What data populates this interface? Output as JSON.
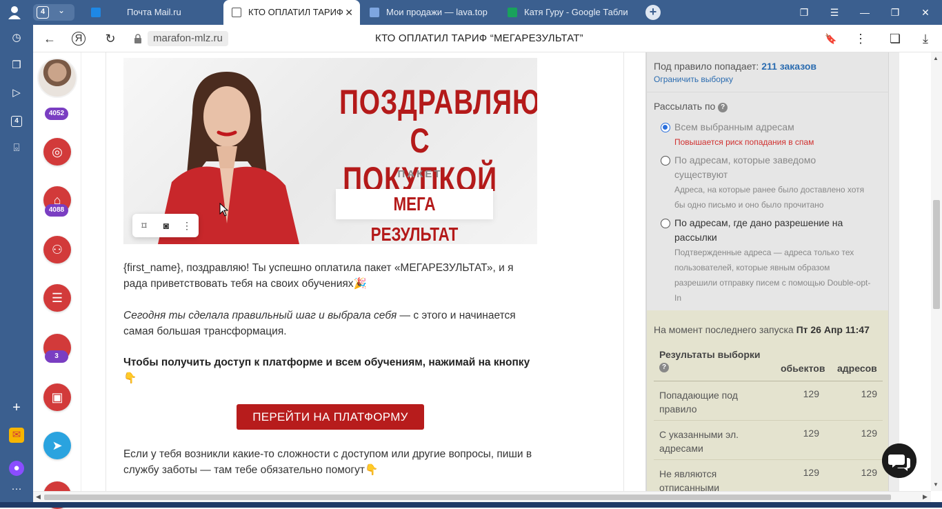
{
  "browser": {
    "tab_count": "4",
    "tabs": [
      {
        "title": "Почта Mail.ru"
      },
      {
        "title": "КТО ОПЛАТИЛ ТАРИФ"
      },
      {
        "title": "Мои продажи — lava.top"
      },
      {
        "title": "Катя Гуру - Google Табли"
      }
    ],
    "host": "marafon-mlz.ru",
    "page_title": "КТО ОПЛАТИЛ ТАРИФ “МЕГАРЕЗУЛЬТАТ”",
    "sidebar_badge": "4"
  },
  "appbar": {
    "badges": [
      "4052",
      "4088",
      "3"
    ]
  },
  "email": {
    "banner": {
      "headline_1": "ПОЗДРАВЛЯЮ",
      "headline_2": "С ПОКУПКОЙ",
      "package_label": "ПАКЕТ",
      "package_name": "МЕГА РЕЗУЛЬТАТ"
    },
    "para1": "{first_name}, поздравляю! Ты успешно оплатила пакет «МЕГАРЕЗУЛЬТАТ», и я рада приветствовать тебя на своих обучениях🎉",
    "para2_italic": "Сегодня ты сделала правильный шаг и выбрала себя",
    "para2_rest": " — с этого и начинается самая большая трансформация.",
    "para3": "Чтобы получить доступ к платформе и всем обучениям, нажимай на кнопку👇",
    "cta_label": "ПЕРЕЙТИ НА ПЛАТФОРМУ",
    "para4": "Если у тебя возникли какие-то сложности с доступом или другие вопросы, пиши в службу заботы — там тебе обязательно помогут👇"
  },
  "panel": {
    "rule_prefix": "Под правило попадает:",
    "rule_count": "211 заказов",
    "limit_link": "Ограничить выборку",
    "send_by_label": "Рассылать по",
    "options": [
      {
        "label": "Всем выбранным адресам",
        "warning": "Повышается риск попадания в спам",
        "checked": true
      },
      {
        "label": "По адресам, которые заведомо существуют",
        "note": "Адреса, на которые ранее было доставлено хотя бы одно письмо и оно было прочитано",
        "checked": false
      },
      {
        "label": "По адресам, где дано разрешение на рассылки",
        "note": "Подтвержденные адреса — адреса только тех пользователей, которые явным образом разрешили отправку писем с помощью Double-opt-In",
        "checked": false
      }
    ],
    "last_run_prefix": "На момент последнего запуска",
    "last_run_value": "Пт 26 Апр 11:47",
    "results_title": "Результаты выборки",
    "col_objects": "обьектов",
    "col_addresses": "адресов",
    "rows": [
      {
        "label": "Попадающие под правило",
        "objects": "129",
        "addresses": "129"
      },
      {
        "label": "С указанными эл. адресами",
        "objects": "129",
        "addresses": "129"
      },
      {
        "label": "Не являются отписанными",
        "objects": "129",
        "addresses": "129"
      }
    ]
  }
}
